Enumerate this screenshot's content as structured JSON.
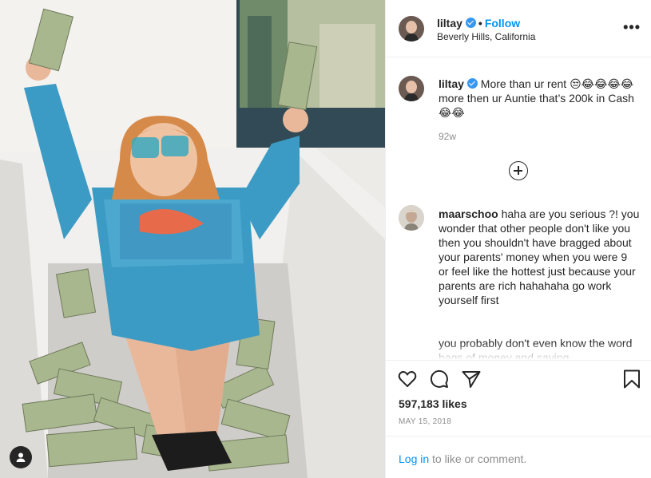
{
  "post": {
    "username": "liltay",
    "follow_label": "Follow",
    "location": "Beverly Hills, California",
    "more_label": "•••"
  },
  "caption": {
    "username": "liltay",
    "text": "More than ur rent 😒😂😂😂😂 more then ur Auntie that’s 200k in Cash 😂😂",
    "time": "92w"
  },
  "comments": [
    {
      "username": "maarschoo",
      "text": "haha are you serious ?! you wonder that other people don't like you then you shouldn't have bragged about your parents' money when you were 9 or feel like the hottest just because your parents are rich hahahaha go work yourself first",
      "text2": "you probably don't even know the word bags of money and saying"
    }
  ],
  "stats": {
    "likes": "597,183 likes",
    "date": "MAY 15, 2018"
  },
  "footer": {
    "login_link": "Log in",
    "login_rest": " to like or comment."
  },
  "icons": {
    "like": "heart-icon",
    "comment": "comment-icon",
    "share": "paper-plane-icon",
    "save": "bookmark-icon",
    "tags": "user-tag-icon",
    "load_more": "plus-circle-icon"
  },
  "colors": {
    "accent": "#0095f6",
    "verified": "#3897f0",
    "text": "#262626",
    "muted": "#8e8e8e",
    "divider": "#efefef"
  }
}
